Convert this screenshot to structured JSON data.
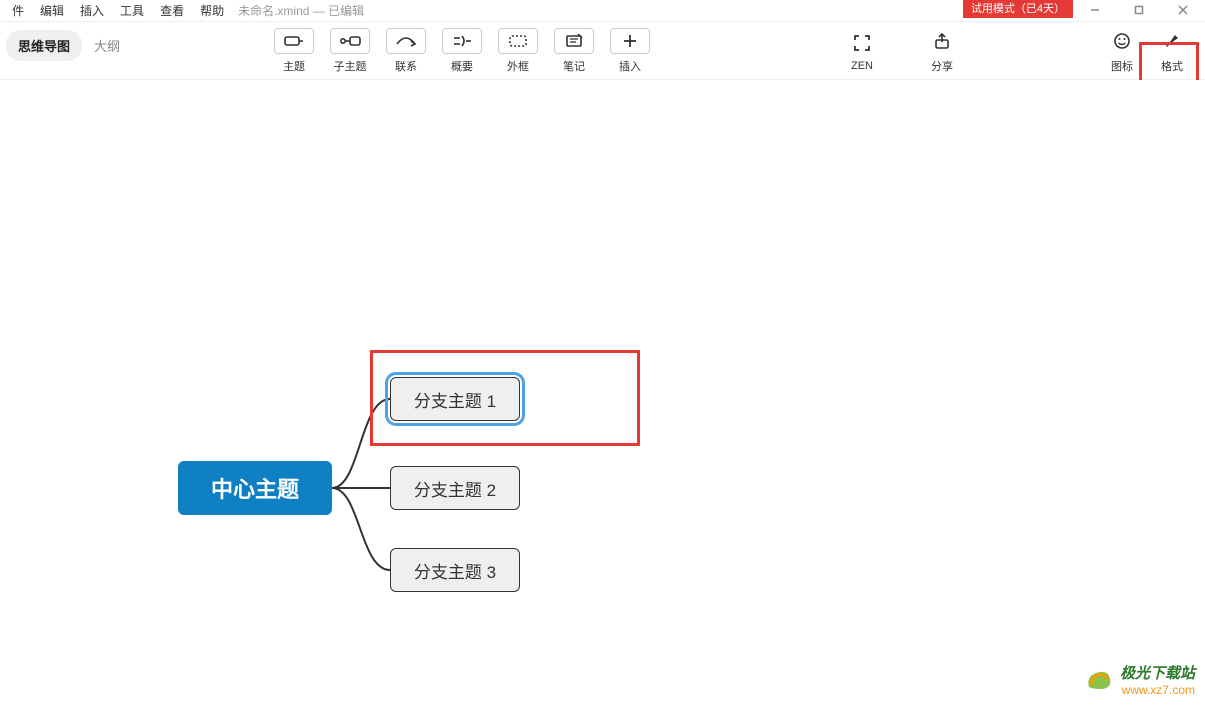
{
  "menubar": {
    "items": [
      "件",
      "编辑",
      "插入",
      "工具",
      "查看",
      "帮助"
    ],
    "doc_title": "未命名.xmind — 已编辑",
    "trial_badge": "试用模式（已4天）"
  },
  "tabs": {
    "mindmap": "思维导图",
    "outline": "大纲"
  },
  "toolbar": {
    "topic": "主题",
    "subtopic": "子主题",
    "relationship": "联系",
    "summary": "概要",
    "boundary": "外框",
    "note": "笔记",
    "insert": "插入",
    "zen": "ZEN",
    "share": "分享",
    "icons": "图标",
    "format": "格式"
  },
  "mindmap": {
    "central": "中心主题",
    "branch1": "分支主题 1",
    "branch2": "分支主题 2",
    "branch3": "分支主题 3"
  },
  "watermark": {
    "line1": "极光下载站",
    "line2": "www.xz7.com"
  }
}
